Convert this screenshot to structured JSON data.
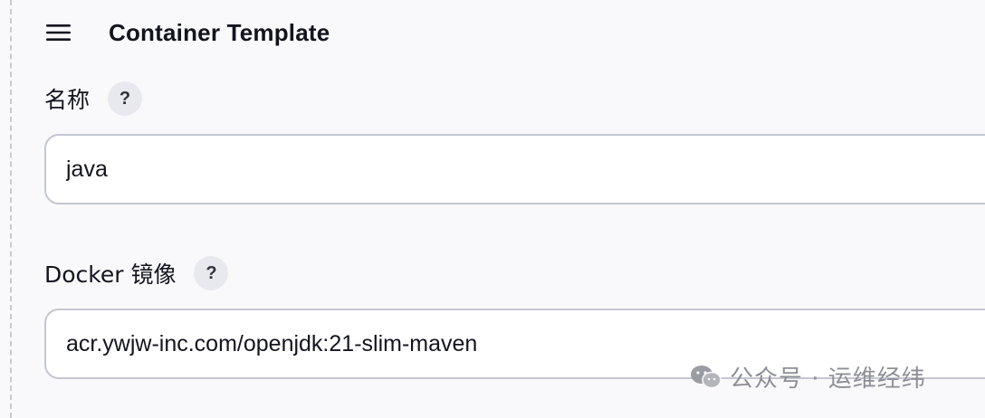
{
  "header": {
    "menu_icon": "hamburger-menu-icon",
    "title": "Container Template"
  },
  "fields": {
    "name": {
      "label": "名称",
      "help": "?",
      "value": "java"
    },
    "docker_image": {
      "label": "Docker 镜像",
      "help": "?",
      "value": "acr.ywjw-inc.com/openjdk:21-slim-maven"
    }
  },
  "watermark": {
    "logo_icon": "wechat-icon",
    "text": "公众号 · 运维经纬"
  }
}
